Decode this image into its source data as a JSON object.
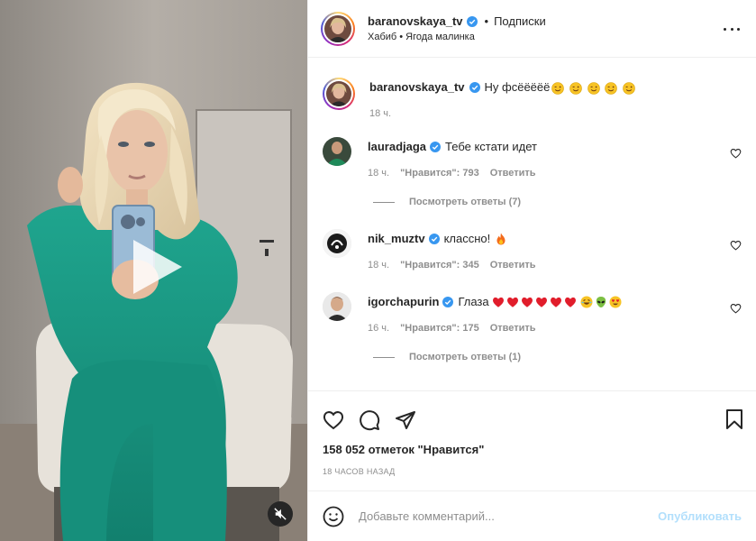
{
  "header": {
    "username": "baranovskaya_tv",
    "separator": "•",
    "follow_label": "Подписки",
    "audio": "Хабиб • Ягода малинка"
  },
  "caption": {
    "username": "baranovskaya_tv",
    "text": "Ну фсёёёёё",
    "emoji_count": 5,
    "time": "18 ч."
  },
  "comments": [
    {
      "username": "lauradjaga",
      "text": "Тебе кстати идет",
      "time": "18 ч.",
      "likes": "\"Нравится\": 793",
      "reply_label": "Ответить",
      "view_replies": "Посмотреть ответы (7)"
    },
    {
      "username": "nik_muztv",
      "text": "классно!",
      "time": "18 ч.",
      "likes": "\"Нравится\": 345",
      "reply_label": "Ответить",
      "view_replies": ""
    },
    {
      "username": "igorchapurin",
      "text": "Глаза",
      "time": "16 ч.",
      "likes": "\"Нравится\": 175",
      "reply_label": "Ответить",
      "view_replies": "Посмотреть ответы (1)"
    }
  ],
  "post": {
    "likes_text": "158 052 отметок \"Нравится\"",
    "time_ago": "18 ЧАСОВ НАЗАД"
  },
  "add_comment": {
    "placeholder": "Добавьте комментарий...",
    "publish_label": "Опубликовать"
  },
  "colors": {
    "accent": "#0095f6",
    "publish_disabled": "#b2dffc",
    "muted_text": "#8e8e8e",
    "border": "#efefef",
    "tracksuit": "#1a9a85"
  },
  "icons": {
    "verified": "verified-badge-icon",
    "more": "more-options-icon",
    "like": "heart-icon",
    "comment": "comment-icon",
    "share": "share-icon",
    "save": "bookmark-icon",
    "emoji": "smiley-icon",
    "play": "play-icon",
    "mute": "muted-speaker-icon"
  }
}
